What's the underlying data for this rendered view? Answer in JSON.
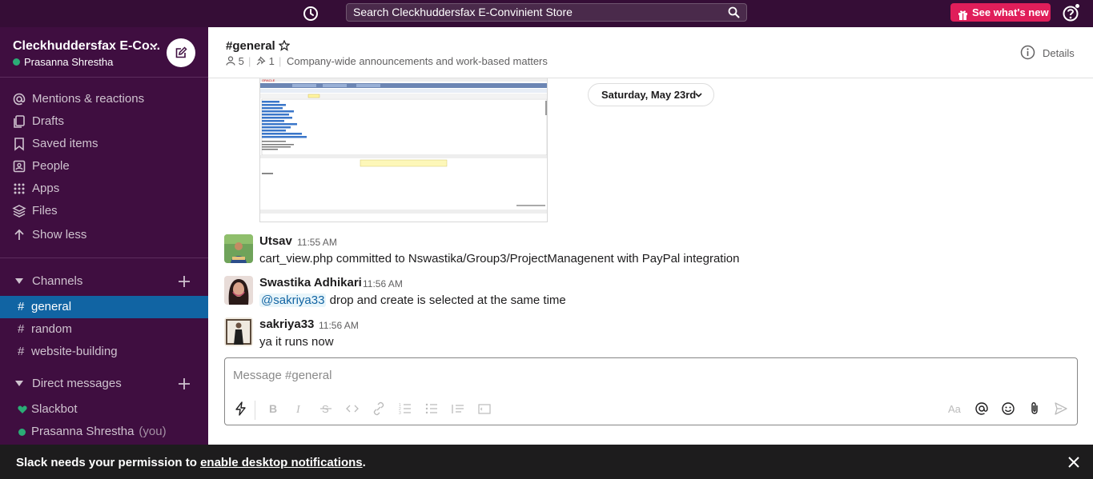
{
  "topbar": {
    "search_placeholder": "Search Cleckhuddersfax E-Convinient Store",
    "whats_new_label": "See what's new"
  },
  "workspace": {
    "name": "Cleckhuddersfax E-Co...",
    "user": "Prasanna Shrestha"
  },
  "nav": {
    "items": [
      {
        "label": "Mentions & reactions",
        "icon": "at-icon"
      },
      {
        "label": "Drafts",
        "icon": "drafts-icon"
      },
      {
        "label": "Saved items",
        "icon": "bookmark-icon"
      },
      {
        "label": "People",
        "icon": "people-icon"
      },
      {
        "label": "Apps",
        "icon": "apps-icon"
      },
      {
        "label": "Files",
        "icon": "files-icon"
      },
      {
        "label": "Show less",
        "icon": "arrow-up-icon"
      }
    ]
  },
  "channels": {
    "header": "Channels",
    "items": [
      {
        "label": "general",
        "active": true
      },
      {
        "label": "random",
        "active": false
      },
      {
        "label": "website-building",
        "active": false
      }
    ]
  },
  "direct_messages": {
    "header": "Direct messages",
    "items": [
      {
        "label": "Slackbot",
        "suffix": ""
      },
      {
        "label": "Prasanna Shrestha",
        "suffix": "(you)"
      }
    ]
  },
  "channel": {
    "title": "#general",
    "members": "5",
    "pins": "1",
    "topic": "Company-wide announcements and work-based matters",
    "details_label": "Details"
  },
  "date_divider": "Saturday, May 23rd",
  "messages": [
    {
      "author": "Utsav",
      "time": "11:55 AM",
      "text": "cart_view.php committed to Nswastika/Group3/ProjectManagenent with PayPal integration"
    },
    {
      "author": "Swastika Adhikari",
      "time": "11:56 AM",
      "mention": "@sakriya33",
      "text": " drop and create is selected at the same time"
    },
    {
      "author": "sakriya33",
      "time": "11:56 AM",
      "text": "ya it runs now"
    }
  ],
  "composer": {
    "placeholder": "Message #general"
  },
  "banner": {
    "prefix": "Slack needs your permission to ",
    "link": "enable desktop notifications",
    "suffix": "."
  },
  "colors": {
    "topbar": "#350d36",
    "sidebar": "#3f0e40",
    "active_channel": "#1164a3",
    "presence": "#2bac76",
    "whats_new": "#e01e5a"
  }
}
